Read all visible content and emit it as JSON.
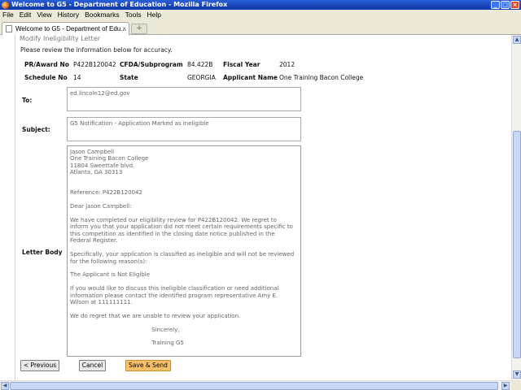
{
  "window": {
    "title": "Welcome to G5 - Department of Education - Mozilla Firefox"
  },
  "menu": {
    "items": [
      "File",
      "Edit",
      "View",
      "History",
      "Bookmarks",
      "Tools",
      "Help"
    ]
  },
  "tabs": {
    "active_label": "Welcome to G5 - Department of Edu...",
    "new_tab": "+"
  },
  "page": {
    "section_title": "Modify Ineligibility Letter",
    "instructions": "Please review the information below for accuracy.",
    "info": {
      "award_label": "PR/Award No",
      "award_value": "P422B120042",
      "cfda_label": "CFDA/Subprogram",
      "cfda_value": "84.422B",
      "fiscal_label": "Fiscal Year",
      "fiscal_value": "2012",
      "schedule_label": "Schedule No",
      "schedule_value": "14",
      "state_label": "State",
      "state_value": "GEORGIA",
      "applicant_label": "Applicant Name",
      "applicant_value": "One Training Bacon College"
    },
    "to_label": "To:",
    "to_value": "ed.lincoln12@ed.gov",
    "subject_label": "Subject:",
    "subject_value": "G5 Notification - Application Marked as Ineligible",
    "letter_label": "Letter Body",
    "letter_body": "Jason Campbell\nOne Training Bacon College\n11804 Sweettafe blvd.\nAtlanta, GA 30313\n\n\nReference: P422B120042\n\nDear Jason Campbell:\n\nWe have completed our eligibility review for P422B120042. We regret to\ninform you that your application did not meet certain requirements specific to\nthis competition as identified in the closing date notice published in the\nFederal Register.\n\nSpecifically, your application is classified as ineligible and will not be reviewed\nfor the following reason(s):\n\nThe Applicant is Not Eligible\n\nIf you would like to discuss this ineligible classification or need additional\ninformation please contact the identified program representative Amy E.\nWilson at 111111111.\n\nWe do regret that we are unable to review your application.\n\n                                             Sincerely,\n\n                                             Training G5",
    "buttons": {
      "previous": "< Previous",
      "cancel": "Cancel",
      "save_send": "Save & Send"
    }
  }
}
